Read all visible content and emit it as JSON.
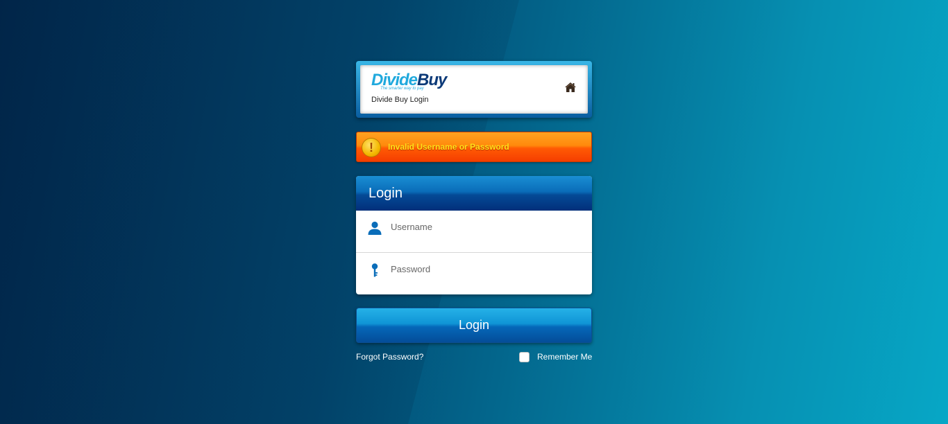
{
  "brand": {
    "logo_part1": "Divide",
    "logo_part2": "Buy",
    "tagline": "The smarter way to pay",
    "subtitle": "Divide Buy Login",
    "home_icon": "home-icon"
  },
  "error": {
    "icon": "warning-icon",
    "message": "Invalid Username or Password"
  },
  "login": {
    "title": "Login",
    "username_placeholder": "Username",
    "username_value": "",
    "username_icon": "user-icon",
    "password_placeholder": "Password",
    "password_value": "",
    "password_icon": "key-icon",
    "button_label": "Login"
  },
  "footer": {
    "forgot_password": "Forgot Password?",
    "remember_me": "Remember Me",
    "remember_checked": false
  },
  "colors": {
    "accent_blue": "#0a6db9",
    "error_orange": "#ff5a04",
    "error_text": "#ffe21a",
    "logo_light": "#20a9dd",
    "logo_dark": "#0c3a78"
  }
}
